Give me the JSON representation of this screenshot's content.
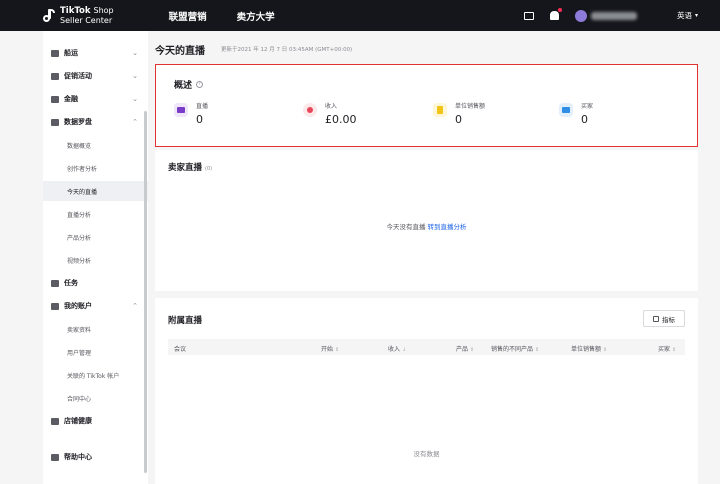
{
  "header": {
    "logo_brand": "TikTok",
    "logo_brand_suffix": "Shop",
    "logo_subtitle": "Seller Center",
    "nav": [
      "联盟营销",
      "卖方大学"
    ],
    "language": "英语"
  },
  "sidebar": {
    "items": [
      {
        "label": "船运",
        "type": "group"
      },
      {
        "label": "促销活动",
        "type": "group"
      },
      {
        "label": "金融",
        "type": "group"
      },
      {
        "label": "数据罗盘",
        "type": "group"
      },
      {
        "label": "数据概览",
        "type": "sub"
      },
      {
        "label": "创作者分析",
        "type": "sub"
      },
      {
        "label": "今天的直播",
        "type": "sub"
      },
      {
        "label": "直播分析",
        "type": "sub"
      },
      {
        "label": "产品分析",
        "type": "sub"
      },
      {
        "label": "视频分析",
        "type": "sub"
      },
      {
        "label": "任务",
        "type": "group"
      },
      {
        "label": "我的账户",
        "type": "group"
      },
      {
        "label": "卖家资料",
        "type": "sub"
      },
      {
        "label": "用户管理",
        "type": "sub"
      },
      {
        "label": "关联的 TikTok 帐户",
        "type": "sub"
      },
      {
        "label": "合同中心",
        "type": "sub"
      },
      {
        "label": "店铺健康",
        "type": "group"
      },
      {
        "label": "帮助中心",
        "type": "group"
      }
    ]
  },
  "page": {
    "title": "今天的直播",
    "updated": "更新于2021 年 12 月 7 日 03:45AM (GMT+00:00)"
  },
  "overview": {
    "title": "概述",
    "metrics": [
      {
        "label": "直播",
        "value": "0",
        "icon": "live-icon",
        "color": "#7a3cc8"
      },
      {
        "label": "收入",
        "value": "£0.00",
        "icon": "revenue-icon",
        "color": "#e8475a"
      },
      {
        "label": "单位销售额",
        "value": "0",
        "icon": "units-sold-icon",
        "color": "#f2c418"
      },
      {
        "label": "买家",
        "value": "0",
        "icon": "buyers-icon",
        "color": "#2f8ee6"
      }
    ]
  },
  "seller_live": {
    "title": "卖家直播",
    "count": "(0)",
    "empty_text": "今天没有直播",
    "link_text": "转到直播分析"
  },
  "affiliate_live": {
    "title": "附属直播",
    "metrics_button": "指标",
    "columns": [
      "会议",
      "开始",
      "收入",
      "产品",
      "销售的不同产品",
      "单位销售额",
      "买家"
    ],
    "empty_text": "没有数据"
  },
  "colors": {
    "topbar": "#15161b",
    "highlight_border": "#e23232",
    "link": "#1b63e8"
  }
}
